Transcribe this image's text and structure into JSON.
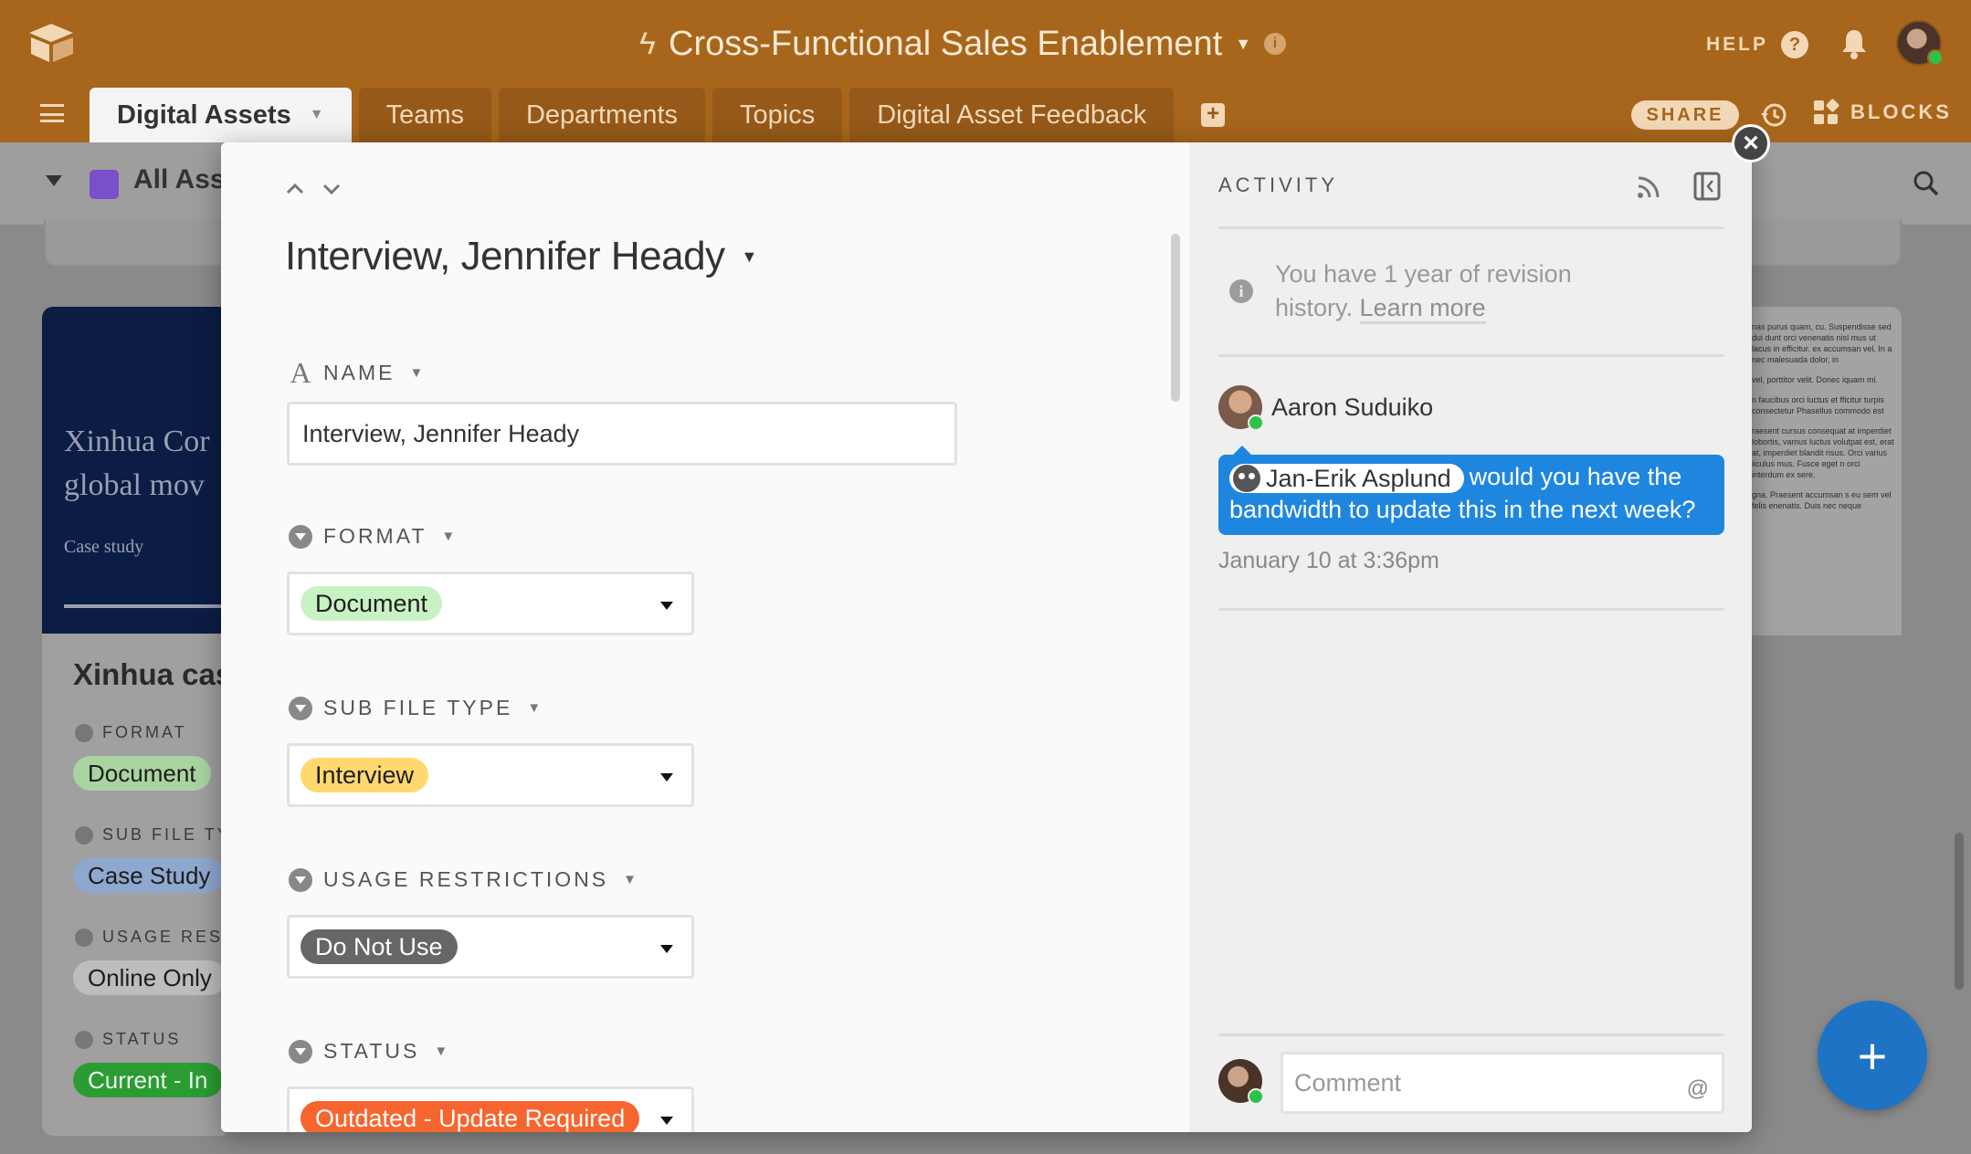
{
  "header": {
    "base_title": "Cross-Functional Sales Enablement",
    "help_label": "HELP",
    "help_glyph": "?",
    "share_label": "SHARE",
    "blocks_label": "BLOCKS"
  },
  "tabs": [
    {
      "label": "Digital Assets",
      "active": true
    },
    {
      "label": "Teams"
    },
    {
      "label": "Departments"
    },
    {
      "label": "Topics"
    },
    {
      "label": "Digital Asset Feedback"
    }
  ],
  "view": {
    "name": "All Ass"
  },
  "background_card": {
    "cover_title_line1": "Xinhua Cor",
    "cover_title_line2": "global mov",
    "cover_subtitle": "Case study",
    "title": "Xinhua cas",
    "fields": [
      {
        "label": "FORMAT",
        "value": "Document",
        "color": "#a9d4a0"
      },
      {
        "label": "SUB FILE TYI",
        "value": "Case Study",
        "color": "#8fa8d0"
      },
      {
        "label": "USAGE REST",
        "value": "Online Only",
        "color": "#bdbdbd"
      },
      {
        "label": "STATUS",
        "value": "Current - In",
        "color": "#2a9c33"
      }
    ]
  },
  "right_card_text": [
    "nas purus quam, cu. Suspendisse sed dui dunt orci venenatis nisl mus ut lacus in efficitur. ex accumsan vel. In a nec malesuada dolor, in",
    "vel, porttitor velit. Donec iquam mi.",
    "n faucibus orci luctus et fficitur turpis consectetur Phasellus commodo est",
    "raesent cursus consequat at imperdiet lobortis, vamus luctus volutpat est, erat at, imperdiet blandit risus. Orci varius iiculus mus. Fusce eget n orci interdum ex sere.",
    "gna. Praesent accumsan s eu sem vel felis enenatis. Duis nec neque"
  ],
  "record": {
    "title": "Interview, Jennifer Heady",
    "fields": {
      "name": {
        "label": "NAME",
        "value": "Interview, Jennifer Heady"
      },
      "format": {
        "label": "FORMAT",
        "value": "Document",
        "color": "#c9f2c4"
      },
      "sub_file_type": {
        "label": "SUB FILE TYPE",
        "value": "Interview",
        "color": "#ffd870"
      },
      "usage_restrictions": {
        "label": "USAGE RESTRICTIONS",
        "value": "Do Not Use",
        "color": "#666666"
      },
      "status": {
        "label": "STATUS",
        "value": "Outdated - Update Required",
        "color": "#f7652e"
      }
    }
  },
  "activity": {
    "title": "ACTIVITY",
    "revision_text": "You have 1 year of revision history.",
    "learn_more": "Learn more",
    "comment": {
      "author": "Aaron Suduiko",
      "mention": "Jan-Erik Asplund",
      "text": "would you have the bandwidth to update this in the next week?",
      "timestamp": "January 10 at 3:36pm"
    },
    "comment_placeholder": "Comment",
    "at_symbol": "@"
  },
  "icons": {
    "close": "×",
    "fab": "+",
    "add_tab": "+"
  }
}
